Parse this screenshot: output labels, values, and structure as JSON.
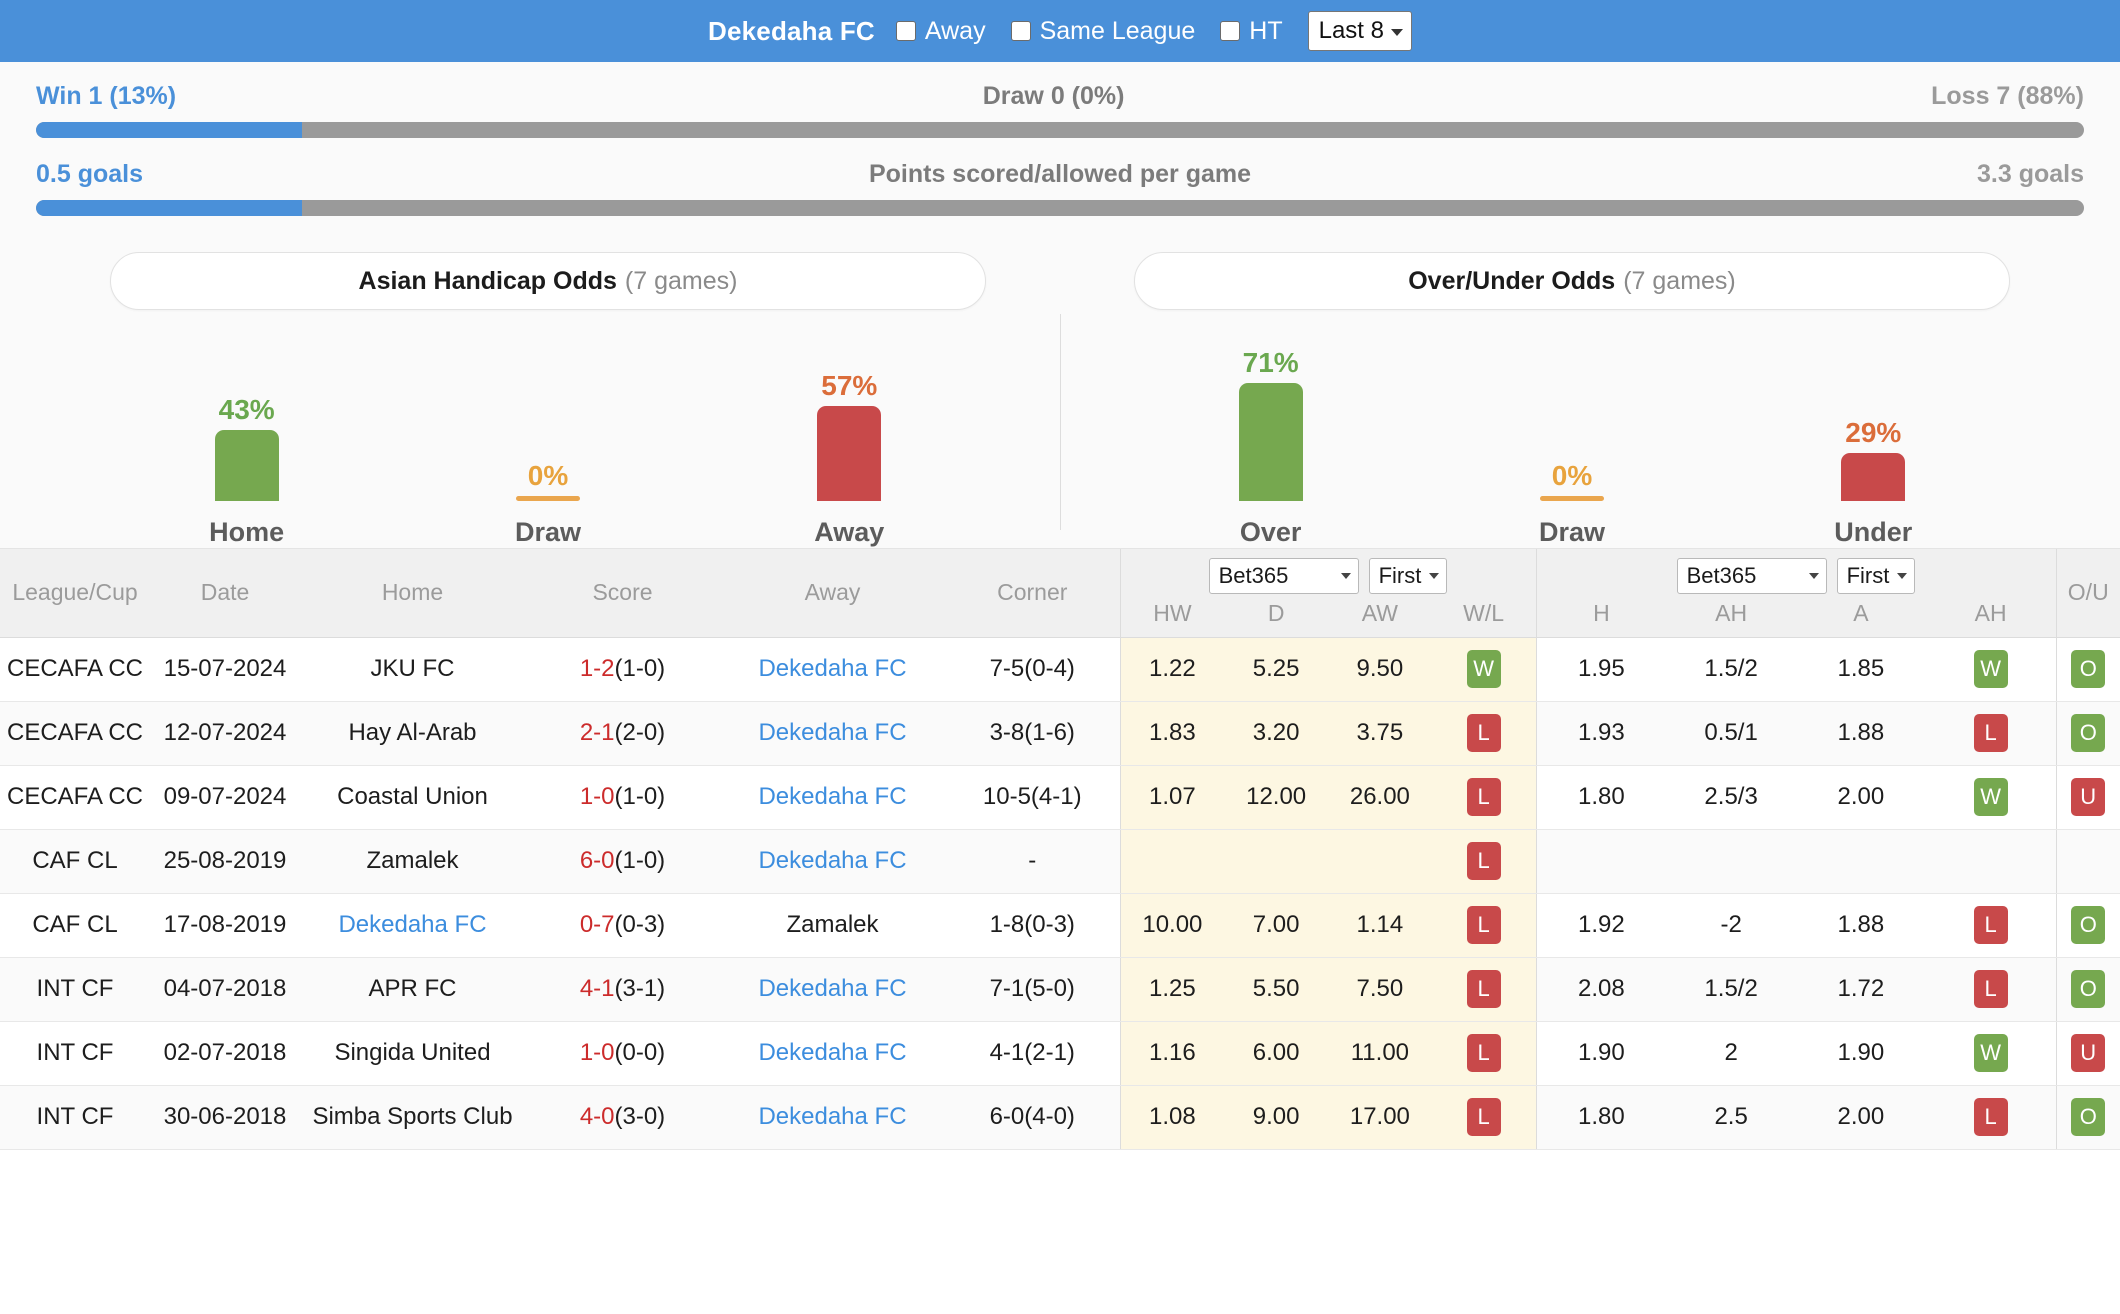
{
  "header": {
    "team": "Dekedaha FC",
    "checkboxes": [
      {
        "label": "Away",
        "checked": false
      },
      {
        "label": "Same League",
        "checked": false
      },
      {
        "label": "HT",
        "checked": false
      }
    ],
    "range_select": {
      "value": "Last 8",
      "icon": "chevron-down-icon"
    }
  },
  "summary": {
    "record": {
      "left": "Win 1 (13%)",
      "center": "Draw 0 (0%)",
      "right": "Loss 7 (88%)",
      "fill_percent": 13
    },
    "goals": {
      "left": "0.5 goals",
      "center": "Points scored/allowed per game",
      "right": "3.3 goals",
      "fill_percent": 13
    }
  },
  "panels": [
    {
      "title_main": "Asian Handicap Odds",
      "title_sub": "(7 games)",
      "bars": [
        {
          "label": "Home",
          "percent": "43%",
          "value": 43,
          "color": "green"
        },
        {
          "label": "Draw",
          "percent": "0%",
          "value": 0,
          "color": "amber"
        },
        {
          "label": "Away",
          "percent": "57%",
          "value": 57,
          "color": "red"
        }
      ]
    },
    {
      "title_main": "Over/Under Odds",
      "title_sub": "(7 games)",
      "bars": [
        {
          "label": "Over",
          "percent": "71%",
          "value": 71,
          "color": "green"
        },
        {
          "label": "Draw",
          "percent": "0%",
          "value": 0,
          "color": "amber"
        },
        {
          "label": "Under",
          "percent": "29%",
          "value": 29,
          "color": "red"
        }
      ]
    }
  ],
  "table": {
    "headers": {
      "league": "League/Cup",
      "date": "Date",
      "home": "Home",
      "score": "Score",
      "away": "Away",
      "corner": "Corner",
      "ou": "O/U"
    },
    "group1": {
      "bookmaker": "Bet365",
      "timing": "First",
      "subheads": [
        "HW",
        "D",
        "AW",
        "W/L"
      ]
    },
    "group2": {
      "bookmaker": "Bet365",
      "timing": "First",
      "subheads": [
        "H",
        "AH",
        "A",
        "AH"
      ]
    },
    "rows": [
      {
        "league": "CECAFA CC",
        "date": "15-07-2024",
        "home": "JKU FC",
        "home_link": false,
        "score_main": "1-2",
        "score_ht": "(1-0)",
        "away": "Dekedaha FC",
        "away_link": true,
        "corner": "7-5(0-4)",
        "hw": "1.22",
        "d": "5.25",
        "aw": "9.50",
        "wl": "W",
        "h": "1.95",
        "ah1": "1.5/2",
        "a": "1.85",
        "ah2": "W",
        "ou": "O"
      },
      {
        "league": "CECAFA CC",
        "date": "12-07-2024",
        "home": "Hay Al-Arab",
        "home_link": false,
        "score_main": "2-1",
        "score_ht": "(2-0)",
        "away": "Dekedaha FC",
        "away_link": true,
        "corner": "3-8(1-6)",
        "hw": "1.83",
        "d": "3.20",
        "aw": "3.75",
        "wl": "L",
        "h": "1.93",
        "ah1": "0.5/1",
        "a": "1.88",
        "ah2": "L",
        "ou": "O"
      },
      {
        "league": "CECAFA CC",
        "date": "09-07-2024",
        "home": "Coastal Union",
        "home_link": false,
        "score_main": "1-0",
        "score_ht": "(1-0)",
        "away": "Dekedaha FC",
        "away_link": true,
        "corner": "10-5(4-1)",
        "hw": "1.07",
        "d": "12.00",
        "aw": "26.00",
        "wl": "L",
        "h": "1.80",
        "ah1": "2.5/3",
        "a": "2.00",
        "ah2": "W",
        "ou": "U"
      },
      {
        "league": "CAF CL",
        "date": "25-08-2019",
        "home": "Zamalek",
        "home_link": false,
        "score_main": "6-0",
        "score_ht": "(1-0)",
        "away": "Dekedaha FC",
        "away_link": true,
        "corner": "-",
        "hw": "",
        "d": "",
        "aw": "",
        "wl": "L",
        "h": "",
        "ah1": "",
        "a": "",
        "ah2": "",
        "ou": ""
      },
      {
        "league": "CAF CL",
        "date": "17-08-2019",
        "home": "Dekedaha FC",
        "home_link": true,
        "score_main": "0-7",
        "score_ht": "(0-3)",
        "away": "Zamalek",
        "away_link": false,
        "corner": "1-8(0-3)",
        "hw": "10.00",
        "d": "7.00",
        "aw": "1.14",
        "wl": "L",
        "h": "1.92",
        "ah1": "-2",
        "a": "1.88",
        "ah2": "L",
        "ou": "O"
      },
      {
        "league": "INT CF",
        "date": "04-07-2018",
        "home": "APR FC",
        "home_link": false,
        "score_main": "4-1",
        "score_ht": "(3-1)",
        "away": "Dekedaha FC",
        "away_link": true,
        "corner": "7-1(5-0)",
        "hw": "1.25",
        "d": "5.50",
        "aw": "7.50",
        "wl": "L",
        "h": "2.08",
        "ah1": "1.5/2",
        "a": "1.72",
        "ah2": "L",
        "ou": "O"
      },
      {
        "league": "INT CF",
        "date": "02-07-2018",
        "home": "Singida United",
        "home_link": false,
        "score_main": "1-0",
        "score_ht": "(0-0)",
        "away": "Dekedaha FC",
        "away_link": true,
        "corner": "4-1(2-1)",
        "hw": "1.16",
        "d": "6.00",
        "aw": "11.00",
        "wl": "L",
        "h": "1.90",
        "ah1": "2",
        "a": "1.90",
        "ah2": "W",
        "ou": "U"
      },
      {
        "league": "INT CF",
        "date": "30-06-2018",
        "home": "Simba Sports Club",
        "home_link": false,
        "score_main": "4-0",
        "score_ht": "(3-0)",
        "away": "Dekedaha FC",
        "away_link": true,
        "corner": "6-0(4-0)",
        "hw": "1.08",
        "d": "9.00",
        "aw": "17.00",
        "wl": "L",
        "h": "1.80",
        "ah1": "2.5",
        "a": "2.00",
        "ah2": "L",
        "ou": "O"
      }
    ]
  },
  "colors": {
    "header_blue": "#4a90d9",
    "bar_green": "#76a84f",
    "bar_red": "#c8494a",
    "bar_amber": "#eaa64e",
    "link_blue": "#3c8dde",
    "score_red": "#cc2b2b",
    "cream": "#fdf7e2"
  }
}
